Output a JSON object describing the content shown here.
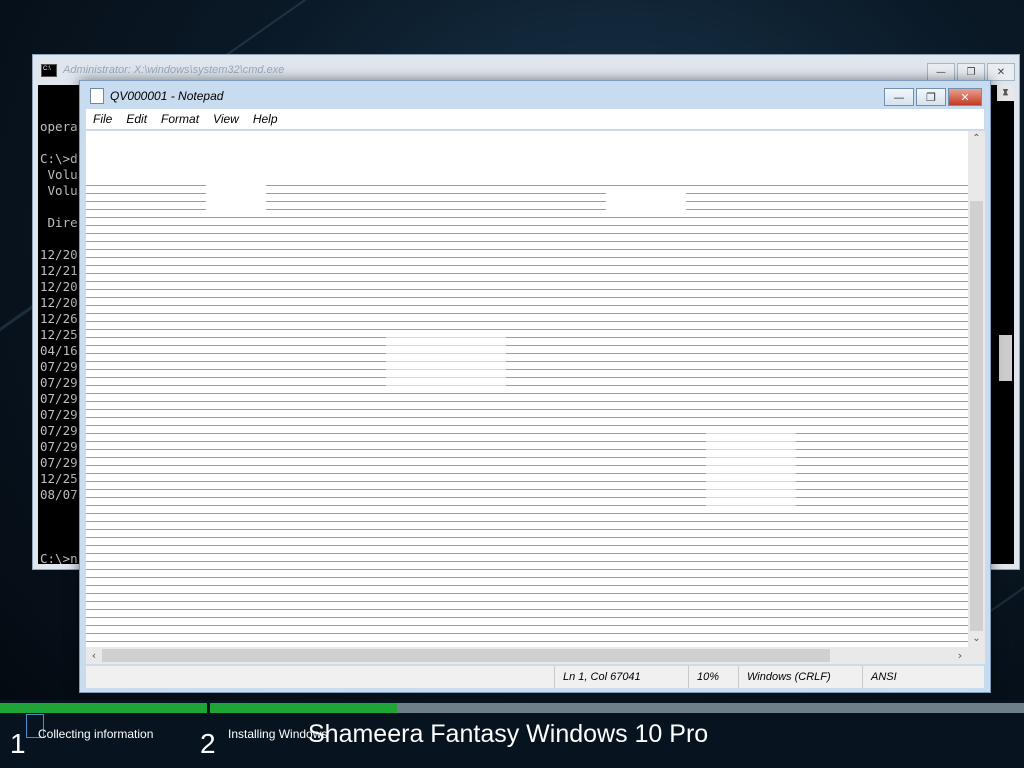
{
  "cmd": {
    "title": "Administrator: X:\\windows\\system32\\cmd.exe",
    "lines": [
      "opera",
      "",
      "C:\\>d",
      " Volu",
      " Volu",
      "",
      " Dire",
      "",
      "12/20",
      "12/21",
      "12/20",
      "12/20",
      "12/26",
      "12/25",
      "04/16",
      "07/29",
      "07/29",
      "07/29",
      "07/29",
      "07/29",
      "07/29",
      "07/29",
      "12/25",
      "08/07",
      "",
      "",
      "",
      "C:\\>n",
      "",
      "C:\\>"
    ],
    "controls": {
      "minimize": "—",
      "maximize": "❐",
      "close": "✕"
    }
  },
  "notepad": {
    "title": "QV000001 - Notepad",
    "menu": [
      "File",
      "Edit",
      "Format",
      "View",
      "Help"
    ],
    "controls": {
      "minimize": "—",
      "maximize": "❐",
      "close": "✕"
    },
    "status": {
      "position": "Ln 1, Col 67041",
      "zoom": "10%",
      "line_endings": "Windows (CRLF)",
      "encoding": "ANSI"
    }
  },
  "setup": {
    "step1": {
      "number": "1",
      "label": "Collecting information",
      "progress": 1.0
    },
    "step2": {
      "number": "2",
      "label": "Installing Windows",
      "progress": 0.23
    },
    "brand": "Shameera Fantasy  Windows 10 Pro",
    "colors": {
      "progress_fill": "#1fa535",
      "progress_track": "#6f7f89"
    }
  }
}
